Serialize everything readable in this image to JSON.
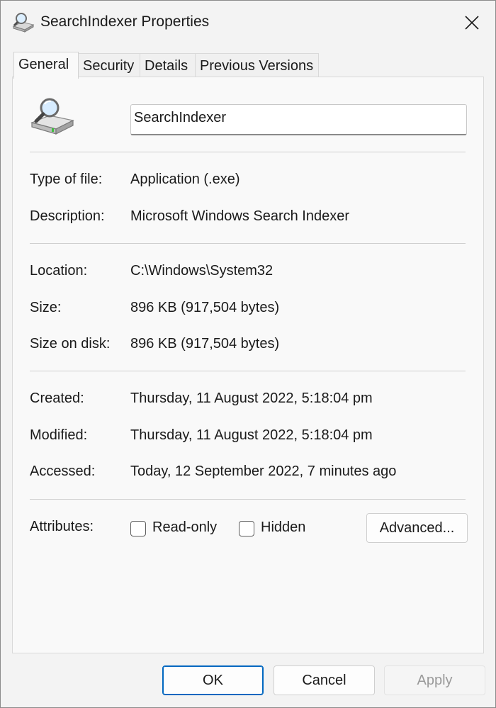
{
  "window": {
    "title": "SearchIndexer Properties",
    "icon": "search-indexer-icon",
    "close_icon": "close-icon"
  },
  "tabs": [
    {
      "label": "General",
      "active": true
    },
    {
      "label": "Security",
      "active": false
    },
    {
      "label": "Details",
      "active": false
    },
    {
      "label": "Previous Versions",
      "active": false
    }
  ],
  "general": {
    "file_name": "SearchIndexer",
    "type_of_file": {
      "label": "Type of file:",
      "value": "Application (.exe)"
    },
    "description": {
      "label": "Description:",
      "value": "Microsoft Windows Search Indexer"
    },
    "location": {
      "label": "Location:",
      "value": "C:\\Windows\\System32"
    },
    "size": {
      "label": "Size:",
      "value": "896 KB (917,504 bytes)"
    },
    "size_on_disk": {
      "label": "Size on disk:",
      "value": "896 KB (917,504 bytes)"
    },
    "created": {
      "label": "Created:",
      "value": "Thursday, 11 August 2022, 5:18:04 pm"
    },
    "modified": {
      "label": "Modified:",
      "value": "Thursday, 11 August 2022, 5:18:04 pm"
    },
    "accessed": {
      "label": "Accessed:",
      "value": "Today, 12 September 2022, 7 minutes ago"
    },
    "attributes": {
      "label": "Attributes:",
      "read_only": {
        "label": "Read-only",
        "checked": false
      },
      "hidden": {
        "label": "Hidden",
        "checked": false
      },
      "advanced_label": "Advanced..."
    }
  },
  "buttons": {
    "ok": "OK",
    "cancel": "Cancel",
    "apply": "Apply"
  },
  "colors": {
    "accent": "#0067c0",
    "window_bg": "#f3f3f3",
    "panel_bg": "#f9f9f9"
  }
}
